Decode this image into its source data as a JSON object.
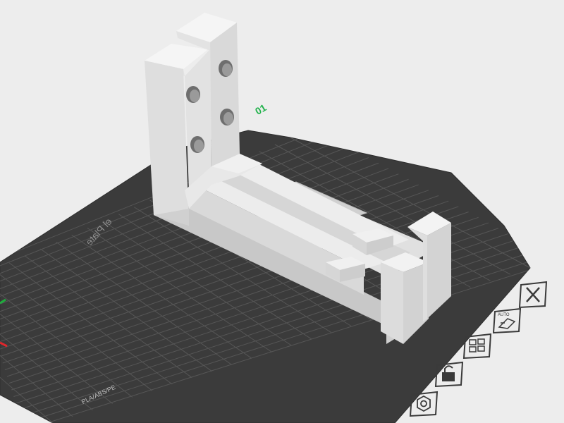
{
  "viewport": {
    "background": "#ededed",
    "bed_color": "#3b3b3b",
    "grid_color": "#565656",
    "model_color": "#e4e4e4"
  },
  "plate": {
    "name_label": "el Plate",
    "materials_label": "PLA/ABS/PE",
    "number_label": "01",
    "number_color": "#22b24c"
  },
  "axes": {
    "x_color": "#e0272c",
    "y_color": "#1fae3d"
  },
  "toolbar": {
    "close_icon": "close-x",
    "auto_orient_label": "AUTO",
    "arrange_icon": "arrange-grid",
    "lock_icon": "padlock",
    "settings_icon": "hex-nut"
  }
}
